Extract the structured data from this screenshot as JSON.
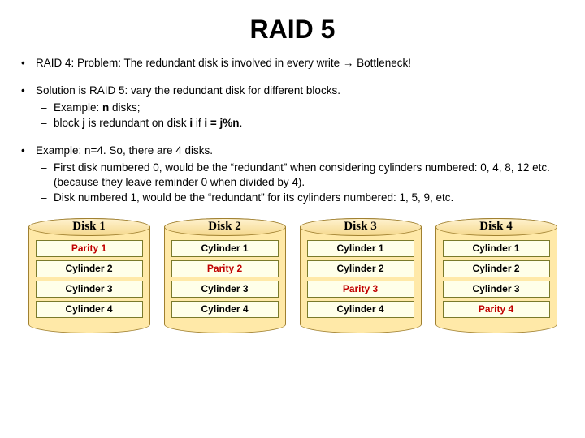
{
  "title": "RAID 5",
  "bullets": {
    "b1": "RAID 4: Problem: The redundant disk is involved in every write → Bottleneck!",
    "b2_lead": "Solution is RAID 5: vary the redundant disk for different blocks.",
    "b2_s1_pre": "Example: ",
    "b2_s1_bold": "n",
    "b2_s1_post": " disks;",
    "b2_s2_a": "block ",
    "b2_s2_b": "j",
    "b2_s2_c": " is redundant on disk ",
    "b2_s2_d": "i",
    "b2_s2_e": " if ",
    "b2_s2_f": "i = j%n",
    "b2_s2_g": ".",
    "b3_lead": "Example: n=4. So, there are 4 disks.",
    "b3_s1": "First disk numbered 0, would be the “redundant” when considering cylinders numbered: 0, 4, 8, 12 etc. (because they leave reminder 0 when divided by 4).",
    "b3_s2": "Disk numbered 1, would be the “redundant” for its cylinders numbered: 1, 5, 9, etc."
  },
  "diagram": {
    "disks": [
      {
        "name": "Disk 1",
        "rows": [
          {
            "label": "Parity 1",
            "parity": true
          },
          {
            "label": "Cylinder 2",
            "parity": false
          },
          {
            "label": "Cylinder 3",
            "parity": false
          },
          {
            "label": "Cylinder 4",
            "parity": false
          }
        ]
      },
      {
        "name": "Disk 2",
        "rows": [
          {
            "label": "Cylinder 1",
            "parity": false
          },
          {
            "label": "Parity 2",
            "parity": true
          },
          {
            "label": "Cylinder 3",
            "parity": false
          },
          {
            "label": "Cylinder 4",
            "parity": false
          }
        ]
      },
      {
        "name": "Disk 3",
        "rows": [
          {
            "label": "Cylinder 1",
            "parity": false
          },
          {
            "label": "Cylinder 2",
            "parity": false
          },
          {
            "label": "Parity 3",
            "parity": true
          },
          {
            "label": "Cylinder 4",
            "parity": false
          }
        ]
      },
      {
        "name": "Disk 4",
        "rows": [
          {
            "label": "Cylinder 1",
            "parity": false
          },
          {
            "label": "Cylinder 2",
            "parity": false
          },
          {
            "label": "Cylinder 3",
            "parity": false
          },
          {
            "label": "Parity 4",
            "parity": true
          }
        ]
      }
    ]
  }
}
